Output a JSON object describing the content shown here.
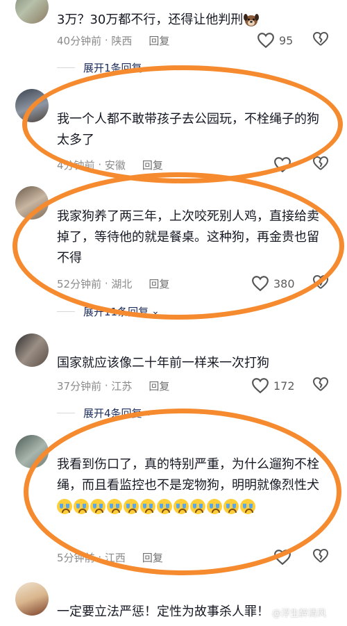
{
  "comments": [
    {
      "name": "",
      "text": "3万？30万都不行，还得让他判刑",
      "time": "40分钟前",
      "location": "陕西",
      "reply": "回复",
      "likes": "95",
      "expand": "展开1条回复"
    },
    {
      "name": "",
      "text": "我一个人都不敢带孩子去公园玩，不栓绳子的狗太多了",
      "time": "4分钟前",
      "location": "安徽",
      "reply": "回复",
      "likes": ""
    },
    {
      "name": "",
      "text": "我家狗养了两三年，上次咬死别人鸡，直接给卖掉了，等待他的就是餐桌。这种狗，再金贵也留不得",
      "time": "52分钟前",
      "location": "湖北",
      "reply": "回复",
      "likes": "380",
      "expand": "展开11条回复"
    },
    {
      "name": "",
      "text": "国家就应该像二十年前一样来一次打狗",
      "time": "37分钟前",
      "location": "江苏",
      "reply": "回复",
      "likes": "172",
      "expand": "展开4条回复"
    },
    {
      "name": "",
      "text": "我看到伤口了，真的特别严重，为什么遛狗不栓绳，而且看监控也不是宠物狗，明明就像烈性犬",
      "time": "5分钟前",
      "location": "江西",
      "reply": "回复",
      "likes": ""
    },
    {
      "name": "",
      "text": "一定要立法严惩！定性为故事杀人罪！"
    }
  ],
  "watermark": "@浮生醉清风",
  "icons": {
    "like": "heart-outline-icon",
    "dislike": "broken-heart-icon",
    "expand": "chevron-down-icon",
    "dog": "dog-face-emoji",
    "cry": "loudly-crying-face-emoji"
  },
  "colors": {
    "highlight": "#f58a2e",
    "expand_link": "#1d2d5c"
  }
}
